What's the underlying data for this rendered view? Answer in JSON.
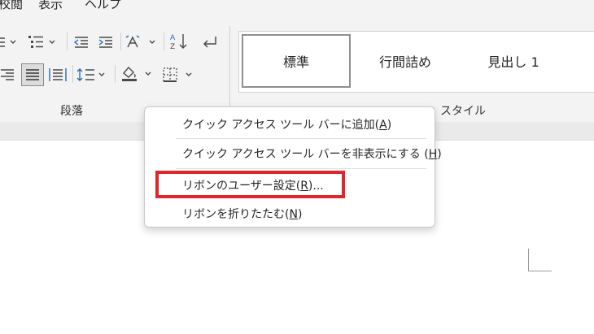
{
  "menubar": {
    "tabs": [
      {
        "label": "校閲"
      },
      {
        "label": "表示"
      },
      {
        "label": "ヘルプ"
      }
    ]
  },
  "ribbon": {
    "paragraph_group_label": "段落",
    "styles_group_label": "スタイル",
    "styles": [
      {
        "label": "標準",
        "selected": true
      },
      {
        "label": "行間詰め"
      },
      {
        "label": "見出し 1"
      }
    ]
  },
  "context_menu": {
    "items": [
      {
        "label": "クイック アクセス ツール バーに追加(",
        "key": "A",
        "suffix": ")"
      },
      {
        "label": "クイック アクセス ツール バーを非表示にする (",
        "key": "H",
        "suffix": ")"
      },
      {
        "label": "リボンのユーザー設定(",
        "key": "R",
        "suffix": ")..."
      },
      {
        "label": "リボンを折りたたむ(",
        "key": "N",
        "suffix": ")"
      }
    ]
  },
  "colors": {
    "highlight": "#e0262b",
    "ribbon_bg": "#f3f3f3"
  }
}
